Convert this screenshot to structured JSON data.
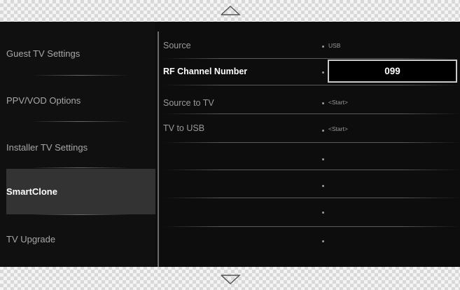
{
  "colors": {
    "panel_bg": "#0d0d0d",
    "selected_bg": "#333333",
    "text_dim": "#a8a8a8",
    "text_active": "#ffffff"
  },
  "nav": {
    "up_icon": "chevron-up-icon",
    "down_icon": "chevron-down-icon"
  },
  "menu": {
    "items": [
      {
        "label": "Guest TV Settings"
      },
      {
        "label": "PPV/VOD Options"
      },
      {
        "label": "Installer TV Settings"
      },
      {
        "label": "SmartClone",
        "selected": true
      },
      {
        "label": "TV Upgrade"
      }
    ]
  },
  "settings": {
    "rows": [
      {
        "label": "Source",
        "value": "USB"
      },
      {
        "label": "RF Channel Number",
        "value": "099",
        "active": true
      },
      {
        "label": "Source to TV",
        "value": "<Start>"
      },
      {
        "label": "TV to USB",
        "value": "<Start>"
      }
    ]
  }
}
